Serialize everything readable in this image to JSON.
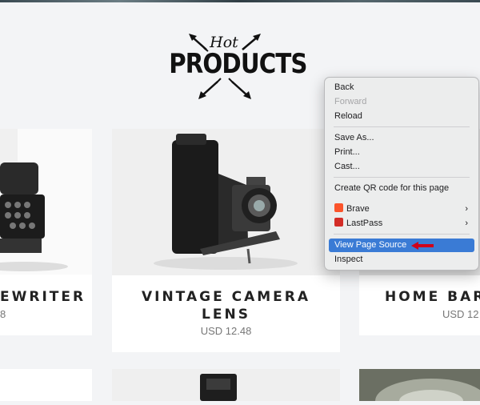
{
  "logo": {
    "script": "Hot",
    "word": "PRODUCTS"
  },
  "products": [
    {
      "title": "EWRITER",
      "price": "8"
    },
    {
      "title": "VINTAGE CAMERA LENS",
      "price": "USD 12.48"
    },
    {
      "title": "HOME BAR",
      "price": "USD 12"
    }
  ],
  "context_menu": {
    "items": [
      {
        "label": "Back",
        "enabled": true
      },
      {
        "label": "Forward",
        "enabled": false
      },
      {
        "label": "Reload",
        "enabled": true
      },
      {
        "label": "Save As...",
        "enabled": true
      },
      {
        "label": "Print...",
        "enabled": true
      },
      {
        "label": "Cast...",
        "enabled": true
      },
      {
        "label": "Create QR code for this page",
        "enabled": true
      },
      {
        "label": "Brave",
        "enabled": true,
        "submenu": true,
        "icon": "brave-lion-icon"
      },
      {
        "label": "LastPass",
        "enabled": true,
        "submenu": true,
        "icon": "lastpass-icon"
      },
      {
        "label": "View Page Source",
        "enabled": true,
        "highlighted": true
      },
      {
        "label": "Inspect",
        "enabled": true
      }
    ],
    "submenu_glyph": "›"
  },
  "colors": {
    "highlight": "#3a7bd5",
    "pointer_arrow": "#d0021b",
    "brave": "#fb542b",
    "lastpass": "#d32d27"
  }
}
